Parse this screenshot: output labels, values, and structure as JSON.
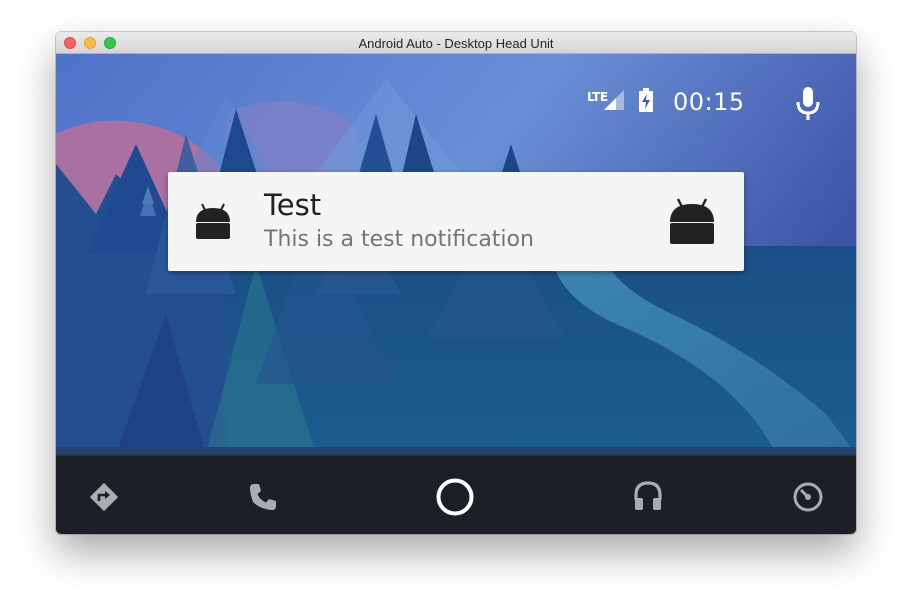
{
  "window": {
    "title": "Android Auto - Desktop Head Unit"
  },
  "status_bar": {
    "network": "LTE",
    "time": "00:15",
    "icons": [
      "signal-icon",
      "battery-charging-icon",
      "microphone-icon"
    ]
  },
  "notification": {
    "title": "Test",
    "body": "This is a test notification",
    "icons": [
      "android-icon",
      "android-large-icon"
    ]
  },
  "nav_bar": {
    "items": [
      "navigation-icon",
      "phone-icon",
      "home-icon",
      "headphones-icon",
      "dashboard-icon"
    ]
  },
  "colors": {
    "notification_bg": "#f5f5f5",
    "nav_bar_bg": "#1c2026",
    "status_text": "#ffffff"
  }
}
